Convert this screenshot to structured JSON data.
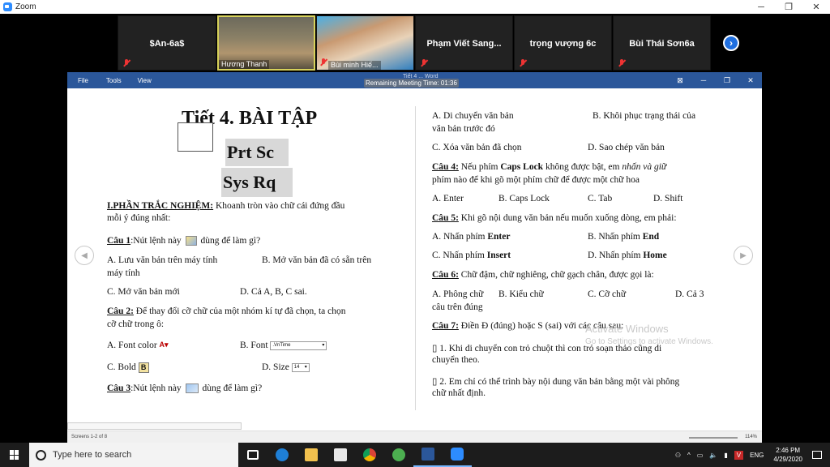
{
  "zoom": {
    "title": "Zoom",
    "window_controls": [
      "─",
      "❐",
      "✕"
    ],
    "participants": [
      {
        "name": "$An-6a$",
        "muted": true,
        "video": false
      },
      {
        "name": "Hương Thanh",
        "muted": false,
        "video": true
      },
      {
        "name": "Bùi minh Hiế...",
        "muted": true,
        "video": true
      },
      {
        "name": "Phạm  Viết  Sang...",
        "muted": true,
        "video": false
      },
      {
        "name": "trọng vượng 6c",
        "muted": true,
        "video": false
      },
      {
        "name": "Bùi Thái Sơn6a",
        "muted": true,
        "video": false
      }
    ],
    "next_icon": "›",
    "meeting_time": "Remaining Meeting Time: 01:36"
  },
  "word": {
    "menu": [
      "File",
      "Tools",
      "View"
    ],
    "doc_title": "Tiết 4 ... Word",
    "window_controls": [
      "⊠",
      "─",
      "❐",
      "✕"
    ],
    "status_left": "Screens 1-2 of 8",
    "zoom_level": "114%",
    "page": {
      "title": "Tiết 4. BÀI TẬP",
      "prtsc": "Prt Sc",
      "sysrq": "Sys Rq",
      "section_heading": "I.PHẦN TRẮC NGHIỆM:",
      "section_intro_1": " Khoanh tròn vào chữ cái đứng đầu",
      "section_intro_2": "mỗi ý đúng nhất:",
      "q1_label": "Câu 1",
      "q1_text_a": ":Nút lệnh này",
      "q1_text_b": " dùng để làm gì?",
      "q1_a_1": "A. Lưu văn bản trên máy tính",
      "q1_b": "B. Mở văn bản đã có sẵn trên",
      "q1_a_2": "máy tính",
      "q1_c": "C. Mở văn bản mới",
      "q1_d": "D. Cả A, B, C sai.",
      "q2_label": "Câu 2:",
      "q2_text_1": " Để thay đổi cỡ chữ của một nhóm kí tự đã chọn, ta chọn",
      "q2_text_2": "cỡ chữ trong ô:",
      "q2_a": "A. Font color",
      "q2_b": "B.  Font",
      "q2_font_value": ".VnTime",
      "q2_c": "C.  Bold",
      "q2_d": "D.  Size",
      "q2_size_value": "14",
      "q3_label": "Câu 3",
      "q3_text_a": ":Nút lệnh này",
      "q3_text_b": " dùng để làm gì?",
      "q3_a_1": "A.  Di chuyển văn bản",
      "q3_b_1": "B. Khôi phục trạng thái của",
      "q3_a_2": "văn bản trước đó",
      "q3_c": "C. Xóa văn bản đã chọn",
      "q3_d": "D. Sao chép văn bản",
      "q4_label": "Câu 4:",
      "q4_text_1a": " Nếu phím ",
      "q4_caps": "Caps Lock",
      "q4_text_1b": " không được bật, em ",
      "q4_italic": "nhấn và giữ",
      "q4_text_2": "phím nào để khi gõ một phím chữ để được một chữ hoa",
      "q4_a": "A. Enter",
      "q4_b": "B. Caps Lock",
      "q4_c": "C. Tab",
      "q4_d": "D. Shift",
      "q5_label": "Câu 5:",
      "q5_text": " Khi gõ nội dung văn bản nếu muốn xuống dòng, em phải:",
      "q5_a": "A.  Nhấn phím ",
      "q5_a_key": "Enter",
      "q5_b": "B.  Nhấn phím ",
      "q5_b_key": "End",
      "q5_c": "C.  Nhấn phím ",
      "q5_c_key": "Insert",
      "q5_d": "D. Nhấn phím ",
      "q5_d_key": "Home",
      "q6_label": "Câu 6:",
      "q6_text": " Chữ đậm, chữ nghiêng, chữ gạch chân, được gọi là:",
      "q6_a": "A.  Phông chữ",
      "q6_b": "B. Kiểu chữ",
      "q6_c": "C. Cỡ chữ",
      "q6_d": "D.  Cả 3",
      "q6_d_2": "câu trên đúng",
      "q7_label": "Câu 7:",
      "q7_text": " Điền Đ (đúng) hoặc S (sai) với các câu sau:",
      "q7_1a": "▯ 1. Khi di chuyển con trỏ chuột thì con trỏ soạn thảo cũng di",
      "q7_1b": "chuyển theo.",
      "q7_2a": "▯ 2. Em chỉ có thể trình bày nội dung văn bản bằng một vài phông",
      "q7_2b": "chữ nhất định."
    }
  },
  "activate": {
    "line1": "Activate Windows",
    "line2": "Go to Settings to activate Windows."
  },
  "taskbar": {
    "search_placeholder": "Type here to search",
    "lang": "ENG",
    "time": "2:46 PM",
    "date": "4/29/2020"
  },
  "colors": {
    "word_blue": "#2b579a",
    "zoom_blue": "#2d8cff",
    "mute_red": "#e33333",
    "speaker_yellow": "#d7d25a"
  }
}
